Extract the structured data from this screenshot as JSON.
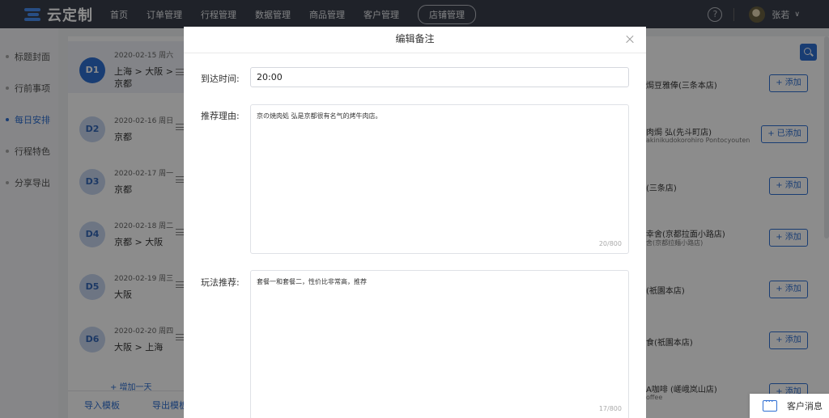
{
  "topbar": {
    "logo_text": "云定制",
    "nav": [
      "首页",
      "订单管理",
      "行程管理",
      "数据管理",
      "商品管理",
      "客户管理"
    ],
    "nav_pill": "店铺管理",
    "help_glyph": "?",
    "user_name": "张若",
    "caret": "∨"
  },
  "sidebar": {
    "items": [
      {
        "label": "标题封面"
      },
      {
        "label": "行前事项"
      },
      {
        "label": "每日安排",
        "active": true
      },
      {
        "label": "行程特色"
      },
      {
        "label": "分享导出"
      }
    ]
  },
  "days": [
    {
      "badge": "D1",
      "date": "2020-02-15 周六",
      "route": "上海 > 大阪 >",
      "route2": "京都",
      "selected": true
    },
    {
      "badge": "D2",
      "date": "2020-02-16 周日",
      "route": "京都",
      "route2": ""
    },
    {
      "badge": "D3",
      "date": "2020-02-17 周一",
      "route": "京都",
      "route2": ""
    },
    {
      "badge": "D4",
      "date": "2020-02-18 周二",
      "route": "京都 > 大阪",
      "route2": ""
    },
    {
      "badge": "D5",
      "date": "2020-02-19 周三",
      "route": "大阪",
      "route2": ""
    },
    {
      "badge": "D6",
      "date": "2020-02-20 周四",
      "route": "大阪 > 上海",
      "route2": ""
    }
  ],
  "day_panel": {
    "add_day": "+ 增加一天",
    "import_label": "导入模板",
    "export_label": "导出模板"
  },
  "places": [
    {
      "name": "焗豆雅俸(三条本店)",
      "sub": "",
      "button": "+ 添加"
    },
    {
      "name": "肉焗 弘(先斗町店)",
      "sub": "akinikudokorohiro Pontocyouten",
      "button": "+ 已添加"
    },
    {
      "name": "(三条店)",
      "sub": "",
      "button": "+ 添加"
    },
    {
      "name": "幸舍(京都拉面小路店)",
      "sub": "舍(京都拉麺小路店)",
      "button": "+ 添加"
    },
    {
      "name": "(祇園本店)",
      "sub": "",
      "button": "+ 添加"
    },
    {
      "name": "食(祇園本店)",
      "sub": "",
      "button": "+ 添加"
    },
    {
      "name": "A咖啡 (嵯峨岚山店)",
      "sub": "offee",
      "button": "+ 添加"
    }
  ],
  "chat": {
    "label": "客户消息"
  },
  "modal": {
    "title": "编辑备注",
    "arrival_label": "到达时间:",
    "arrival_value": "20:00",
    "reason_label": "推荐理由:",
    "reason_text": "京の焼肉処 弘是京都很有名气的烤牛肉店。",
    "reason_count": "20/800",
    "play_label": "玩法推荐:",
    "play_text": "套餐一和套餐二，性价比非常高，推荐",
    "play_count": "17/800"
  },
  "colors": {
    "accent": "#2f6fd2",
    "topbar": "#3a3f4b"
  }
}
